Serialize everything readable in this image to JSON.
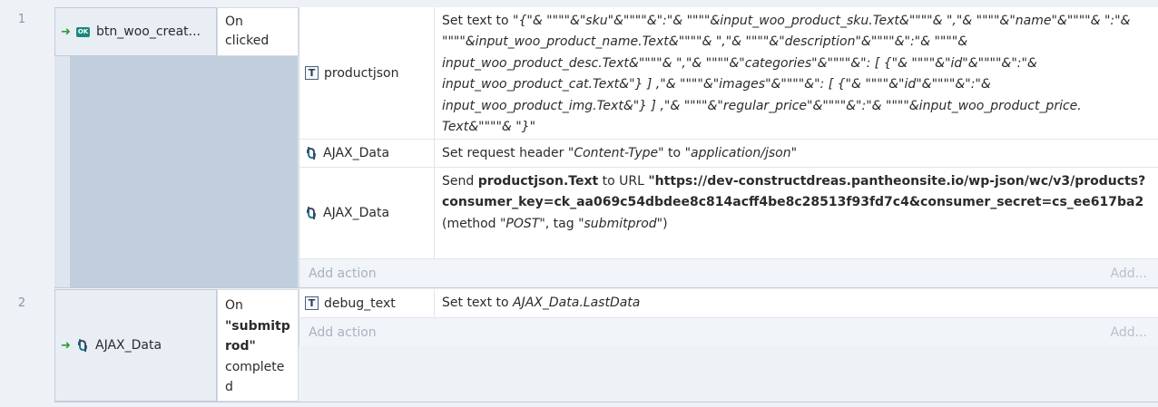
{
  "events": [
    {
      "number": "1",
      "object": {
        "name": "btn_woo_creat...",
        "icon": "button-ok-icon",
        "icon_text": "OK"
      },
      "condition": {
        "line1": "On",
        "line2": "clicked"
      },
      "actions": [
        {
          "object": "productjson",
          "icon": "text-object-icon",
          "description": {
            "prefix": "Set text to ",
            "expr": "\"{\"& \"\"\"\"&\"sku\"&\"\"\"\"&\":\"& \"\"\"\"&input_woo_product_sku.Text&\"\"\"\"& \",\"& \"\"\"\"&\"name\"&\"\"\"\"& \":\"& \"\"\"\"&input_woo_product_name.Text&\"\"\"\"& \",\"& \"\"\"\"&\"description\"&\"\"\"\"&\":\"& \"\"\"\"& input_woo_product_desc.Text&\"\"\"\"& \",\"& \"\"\"\"&\"categories\"&\"\"\"\"&\": [ {\"& \"\"\"\"&\"id\"&\"\"\"\"&\":\"& input_woo_product_cat.Text&\"} ] ,\"& \"\"\"\"&\"images\"&\"\"\"\"&\": [ {\"& \"\"\"\"&\"id\"&\"\"\"\"&\":\"& input_woo_product_img.Text&\"} ] ,\"& \"\"\"\"&\"regular_price\"&\"\"\"\"&\":\"& \"\"\"\"&input_woo_product_price. Text&\"\"\"\"& \"}\""
          }
        },
        {
          "object": "AJAX_Data",
          "icon": "ajax-icon",
          "description": {
            "p1": "Set request header ",
            "header": "\"Content-Type\"",
            "p2": " to ",
            "value": "\"application/json\""
          }
        },
        {
          "object": "AJAX_Data",
          "icon": "ajax-icon",
          "description": {
            "p1": "Send ",
            "data": "productjson.Text",
            "p2": " to URL ",
            "url": "\"https://dev-constructdreas.pantheonsite.io/wp-json/wc/v3/products?consumer_key=ck_aa069c54dbdee8c814acff4be8c28513f93fd7c4&consumer_secret=cs_ee617ba2",
            "p3": "(method ",
            "method": "\"POST\"",
            "p4": ", tag ",
            "tag": "\"submitprod\"",
            "p5": ")"
          }
        }
      ],
      "add_action": "Add action",
      "add_more": "Add..."
    },
    {
      "number": "2",
      "object": {
        "name": "AJAX_Data",
        "icon": "ajax-icon"
      },
      "condition": {
        "line1": "On",
        "tag": "\"submitp rod\"",
        "line3": "complete d"
      },
      "actions": [
        {
          "object": "debug_text",
          "icon": "text-object-icon",
          "description": {
            "prefix": "Set text to ",
            "expr": "AJAX_Data.LastData"
          }
        }
      ],
      "add_action": "Add action",
      "add_more": "Add..."
    }
  ],
  "colors": {
    "accent_green": "#2aa02a",
    "badge_teal": "#178a7e",
    "event_blue": "#c1cede"
  }
}
